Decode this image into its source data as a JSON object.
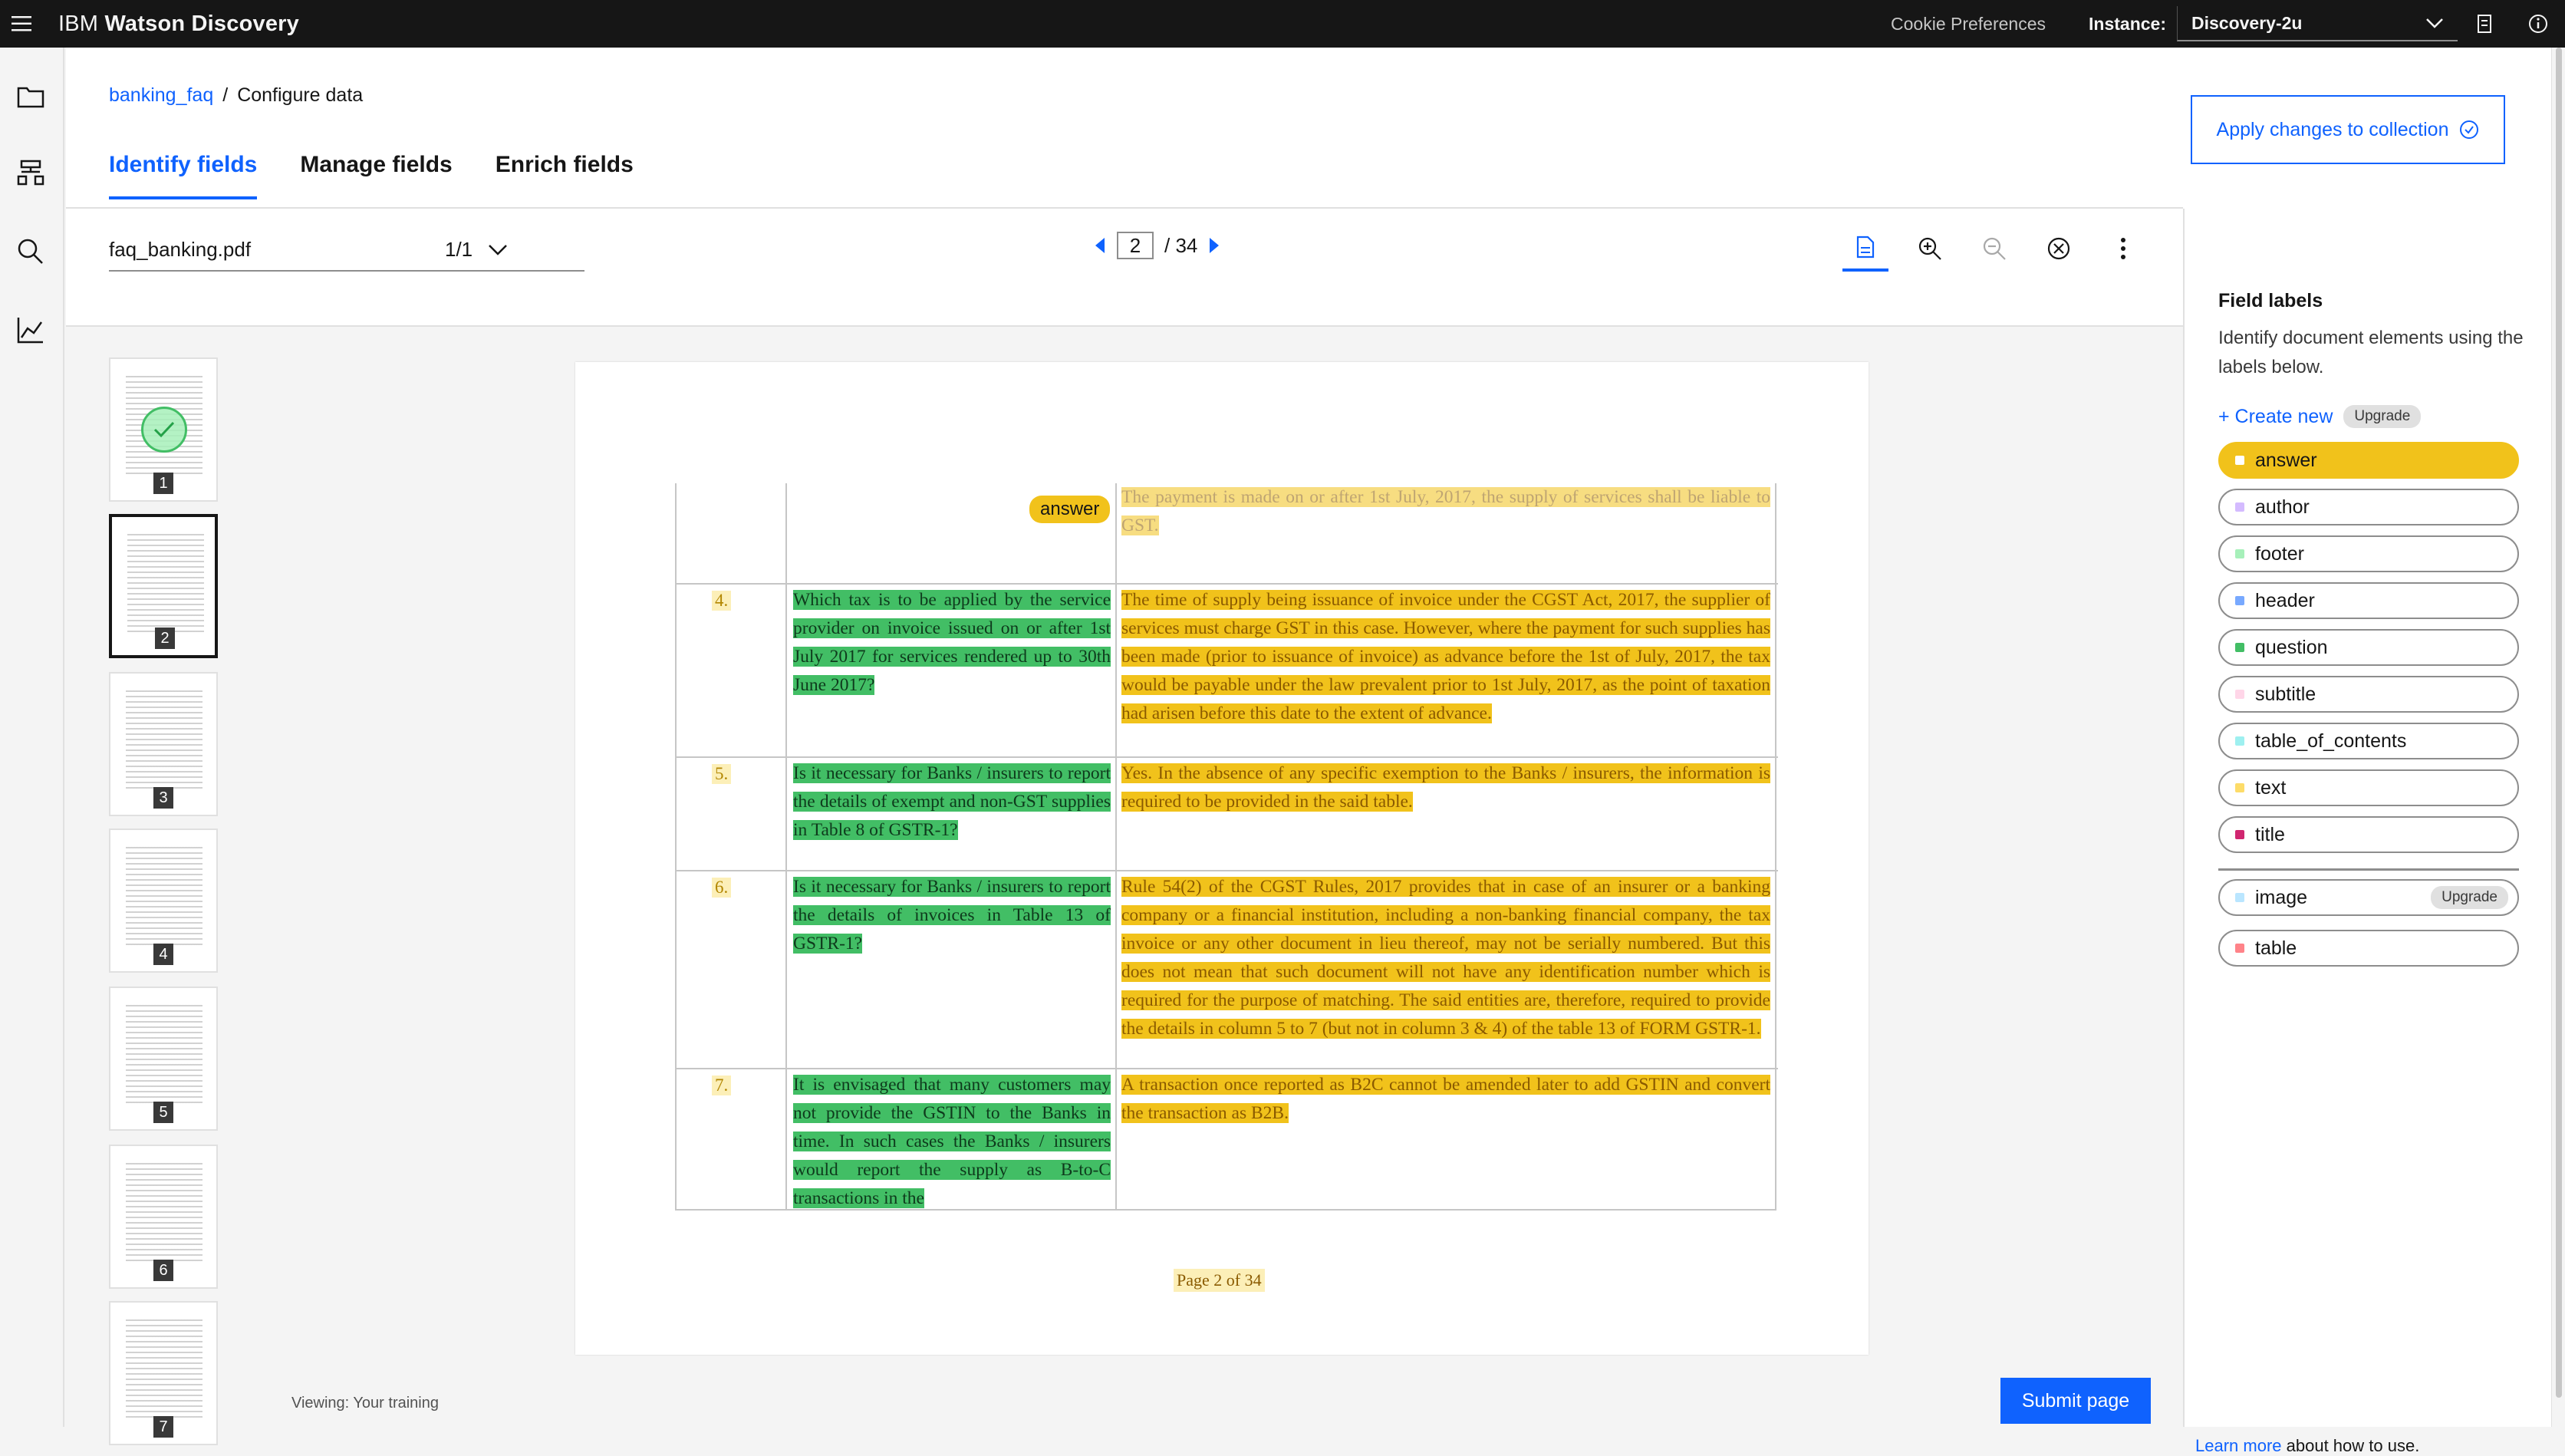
{
  "topbar": {
    "brand_prefix": "IBM",
    "brand_name": "Watson Discovery",
    "cookie": "Cookie Preferences",
    "instance_label": "Instance:",
    "instance_value": "Discovery-2u"
  },
  "breadcrumb": {
    "parent": "banking_faq",
    "separator": "/",
    "current": "Configure data"
  },
  "apply_button": "Apply changes to collection",
  "tabs": [
    "Identify fields",
    "Manage fields",
    "Enrich fields"
  ],
  "toolbar": {
    "filename": "faq_banking.pdf",
    "file_count": "1/1",
    "page_current": "2",
    "page_total": "/ 34"
  },
  "thumbnails": [
    "1",
    "2",
    "3",
    "4",
    "5",
    "6",
    "7"
  ],
  "document": {
    "row0_answer": "The payment is made on or after 1st July, 2017, the supply of services shall be liable to GST.",
    "rows": [
      {
        "num": "4.",
        "question": "Which tax is to be applied by the service provider on invoice issued on or after 1st July 2017 for services rendered up to 30th June 2017?",
        "answer": "The time of supply being issuance of invoice under the CGST Act, 2017, the supplier of services must charge GST in this case. However, where the payment for such supplies has been made (prior to issuance of invoice) as advance before the 1st of July, 2017, the tax would be payable under the law prevalent prior to 1st July, 2017, as the point of taxation had arisen before this date to the extent of advance."
      },
      {
        "num": "5.",
        "question": "Is it necessary for Banks / insurers to report the details of exempt and non-GST supplies in Table 8 of GSTR-1?",
        "answer": "Yes. In the absence of any specific exemption to the Banks / insurers, the information is required to be provided in the said table."
      },
      {
        "num": "6.",
        "question": "Is it necessary for Banks / insurers to report the details of invoices in Table 13 of GSTR-1?",
        "answer": "Rule 54(2) of the CGST Rules, 2017 provides that in case of an insurer or a banking company or a financial institution, including a non-banking financial company, the tax invoice or any other document in lieu thereof, may not be serially numbered. But this does not mean that such document will not have any identification number which is required for the purpose of matching. The said entities are, therefore, required to provide the details in column 5 to 7 (but not in column 3 & 4) of the table 13 of FORM GSTR-1."
      },
      {
        "num": "7.",
        "question": "It is envisaged that many customers may not provide the GSTIN to the Banks in time. In such cases the Banks / insurers would report the supply as B-to-C transactions in the",
        "answer": "A transaction once reported as B2C cannot be amended later to add GSTIN and convert the transaction as B2B."
      }
    ],
    "tag": "answer",
    "page_footer": "Page 2 of 34"
  },
  "viewing": "Viewing: Your training",
  "submit": "Submit page",
  "panel": {
    "title": "Field labels",
    "description": "Identify document elements using the labels below.",
    "create": "+ Create new",
    "upgrade": "Upgrade",
    "labels": [
      {
        "name": "answer",
        "color": "#f1c21b"
      },
      {
        "name": "author",
        "color": "#d4bbff"
      },
      {
        "name": "footer",
        "color": "#a7f0ba"
      },
      {
        "name": "header",
        "color": "#78a9ff"
      },
      {
        "name": "question",
        "color": "#42be65"
      },
      {
        "name": "subtitle",
        "color": "#ffd6e8"
      },
      {
        "name": "table_of_contents",
        "color": "#9ef0f0"
      },
      {
        "name": "text",
        "color": "#fddc69"
      },
      {
        "name": "title",
        "color": "#d02670"
      }
    ],
    "extra_labels": [
      {
        "name": "image",
        "color": "#bae6ff"
      },
      {
        "name": "table",
        "color": "#ff8389"
      }
    ],
    "learn_link": "Learn more",
    "learn_rest": " about how to use."
  }
}
